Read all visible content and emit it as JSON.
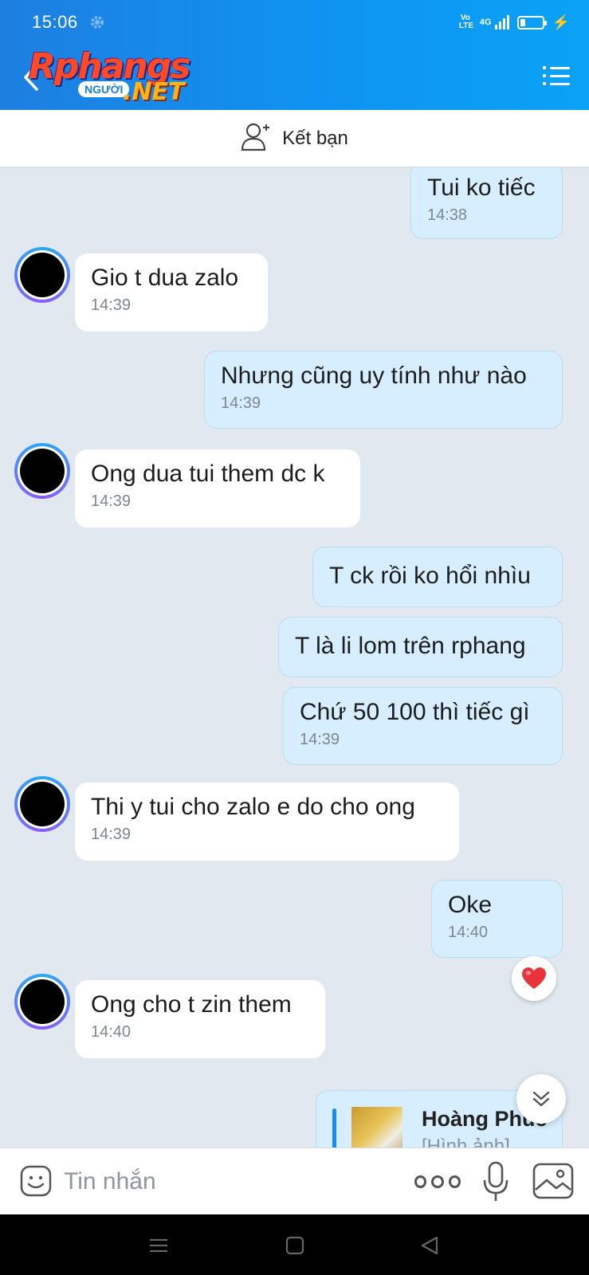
{
  "status_bar": {
    "time": "15:06",
    "network_volte": "Vo\nLTE",
    "network_type": "4G"
  },
  "header": {
    "logo_main": "Rphangs",
    "logo_badge": "NGƯỜI",
    "logo_suffix": ".NET"
  },
  "friend_bar": {
    "label": "Kết bạn"
  },
  "messages": [
    {
      "side": "out",
      "text": "Tui ko tiếc",
      "time": "14:38"
    },
    {
      "side": "in",
      "text": "Gio t dua zalo",
      "time": "14:39"
    },
    {
      "side": "out",
      "text": "Nhưng cũng uy tính như nào",
      "time": "14:39"
    },
    {
      "side": "in",
      "text": "Ong dua tui them dc k",
      "time": "14:39"
    },
    {
      "side": "out",
      "text": "T ck rồi ko hổi nhìu",
      "time": ""
    },
    {
      "side": "out",
      "text": "T là li lom trên rphang",
      "time": ""
    },
    {
      "side": "out",
      "text": "Chứ 50 100 thì tiếc gì",
      "time": "14:39"
    },
    {
      "side": "in",
      "text": "Thi y tui cho zalo e do cho ong",
      "time": "14:39"
    },
    {
      "side": "out",
      "text": "Oke",
      "time": "14:40"
    },
    {
      "side": "in",
      "text": "Ong cho t zin them",
      "time": "14:40"
    }
  ],
  "reaction": {
    "emoji": "heart",
    "color": "#e8323c"
  },
  "contact_card": {
    "name": "Hoàng Phúc",
    "subtitle": "[Hình ảnh]"
  },
  "input_bar": {
    "placeholder": "Tin nhắn"
  },
  "colors": {
    "header_gradient_start": "#1d7fe0",
    "header_gradient_end": "#0aa2f6",
    "chat_background": "#e2e8f0",
    "outgoing_bubble": "#d6eeff",
    "incoming_bubble": "#ffffff",
    "accent": "#1a8cf0"
  }
}
